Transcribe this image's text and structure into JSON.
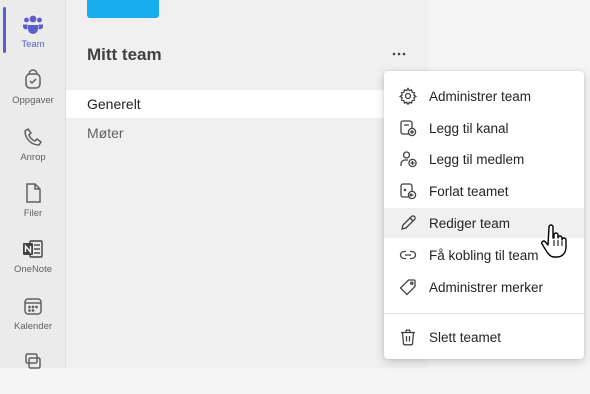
{
  "rail": {
    "items": [
      {
        "label": "Team",
        "icon": "teams-icon",
        "active": true
      },
      {
        "label": "Oppgaver",
        "icon": "tasks-icon"
      },
      {
        "label": "Anrop",
        "icon": "phone-icon"
      },
      {
        "label": "Filer",
        "icon": "file-icon"
      },
      {
        "label": "OneNote",
        "icon": "onenote-icon"
      },
      {
        "label": "Kalender",
        "icon": "calendar-icon"
      }
    ]
  },
  "team": {
    "name": "Mitt team",
    "logo_color": "#18aeee",
    "more_label": "..."
  },
  "channels": [
    {
      "label": "Generelt"
    },
    {
      "label": "Møter"
    }
  ],
  "menu": {
    "items": [
      {
        "label": "Administrer team",
        "icon": "gear-icon"
      },
      {
        "label": "Legg til kanal",
        "icon": "add-channel-icon"
      },
      {
        "label": "Legg til medlem",
        "icon": "add-member-icon"
      },
      {
        "label": "Forlat teamet",
        "icon": "leave-team-icon"
      },
      {
        "label": "Rediger team",
        "icon": "pencil-icon"
      },
      {
        "label": "Få kobling til team",
        "icon": "link-icon"
      },
      {
        "label": "Administrer merker",
        "icon": "tag-icon"
      },
      {
        "label": "Slett teamet",
        "icon": "trash-icon"
      }
    ]
  },
  "colors": {
    "accent": "#5b5fc7",
    "brand_tile": "#18aeee"
  }
}
